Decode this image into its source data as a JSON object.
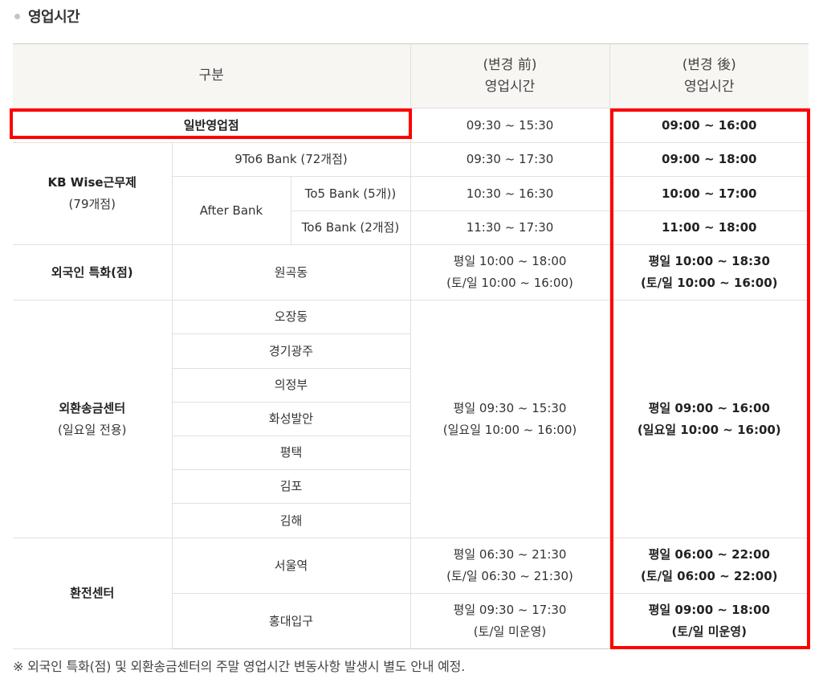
{
  "section": {
    "title": "영업시간"
  },
  "headers": {
    "category": "구분",
    "before_line1": "(변경 前)",
    "before_line2": "영업시간",
    "after_line1": "(변경 後)",
    "after_line2": "영업시간"
  },
  "general": {
    "label": "일반영업점",
    "before": "09:30 ~ 15:30",
    "after": "09:00 ~ 16:00"
  },
  "kbwise": {
    "label": "KB Wise근무제",
    "sublabel": "(79개점)",
    "to6": {
      "label": "9To6 Bank (72개점)",
      "before": "09:30 ~ 17:30",
      "after": "09:00 ~ 18:00"
    },
    "afterbank": {
      "label": "After Bank",
      "to5": {
        "label": "To5 Bank (5개))",
        "before": "10:30 ~ 16:30",
        "after": "10:00 ~ 17:00"
      },
      "to6": {
        "label": "To6 Bank (2개점)",
        "before": "11:30 ~ 17:30",
        "after": "11:00 ~ 18:00"
      }
    }
  },
  "foreign": {
    "label": "외국인 특화(점)",
    "branch": "원곡동",
    "before_line1": "평일 10:00 ~ 18:00",
    "before_line2": "(토/일 10:00 ~ 16:00)",
    "after_line1": "평일 10:00 ~ 18:30",
    "after_line2": "(토/일 10:00 ~ 16:00)"
  },
  "remit": {
    "label": "외환송금센터",
    "sublabel": "(일요일 전용)",
    "branches": [
      "오장동",
      "경기광주",
      "의정부",
      "화성발안",
      "평택",
      "김포",
      "김해"
    ],
    "before_line1": "평일 09:30 ~ 15:30",
    "before_line2": "(일요일 10:00 ~ 16:00)",
    "after_line1": "평일 09:00 ~ 16:00",
    "after_line2": "(일요일 10:00 ~ 16:00)"
  },
  "exchange": {
    "label": "환전센터",
    "seoul": {
      "branch": "서울역",
      "before_line1": "평일 06:30 ~ 21:30",
      "before_line2": "(토/일 06:30 ~ 21:30)",
      "after_line1": "평일 06:00 ~ 22:00",
      "after_line2": "(토/일 06:00 ~ 22:00)"
    },
    "hongdae": {
      "branch": "홍대입구",
      "before_line1": "평일 09:30 ~ 17:30",
      "before_line2": "(토/일 미운영)",
      "after_line1": "평일 09:00 ~ 18:00",
      "after_line2": "(토/일 미운영)"
    }
  },
  "footnote": "※ 외국인 특화(점) 및 외환송금센터의 주말 영업시간 변동사항 발생시 별도 안내 예정.",
  "colors": {
    "highlight": "#ff0000",
    "header_bg": "#f7f6f3",
    "border": "#e2e0db"
  }
}
